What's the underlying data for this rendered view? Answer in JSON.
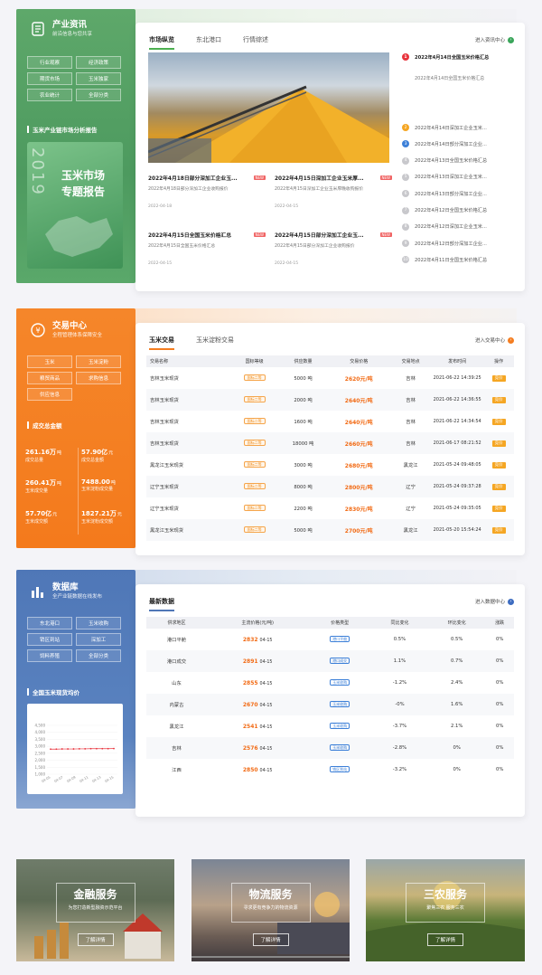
{
  "industry": {
    "title": "产业资讯",
    "subtitle": "前沿信息与您共享",
    "buttons": [
      "行业观察",
      "经济政策",
      "期货市场",
      "玉米独家",
      "农业统计",
      "全部分类"
    ],
    "report_section": "玉米产业链市场分析报告",
    "report_year": "2019",
    "report_title1": "玉米市场",
    "report_title2": "专题报告",
    "tabs": [
      "市场纵览",
      "东北港口",
      "行情综述"
    ],
    "more": "进入资讯中心",
    "news": [
      {
        "title": "2022年4月18日部分深加工企业玉...",
        "desc": "2022年4月18日部分深加工企业收购报价",
        "date": "2022-04-18",
        "badge": "NEW"
      },
      {
        "title": "2022年4月15日深加工企业玉米厚...",
        "desc": "2022年4月15日深加工企业玉米厚晚收购报价",
        "date": "2022-04-15",
        "badge": "NEW"
      },
      {
        "title": "2022年4月15日全国玉米价格汇总",
        "desc": "2022年4月15日全国玉米价格汇总",
        "date": "2022-04-15",
        "badge": "NEW"
      },
      {
        "title": "2022年4月15日部分深加工企业玉...",
        "desc": "2022年4月15日部分深加工企业收购报价",
        "date": "2022-04-15",
        "badge": "NEW"
      }
    ],
    "top_item": {
      "n": "1",
      "title": "2022年4月14日全国玉米价格汇总",
      "desc": "2022年4月14日全国玉米价格汇总"
    },
    "list": [
      {
        "n": "2",
        "t": "2022年4月14日深加工企业玉米..."
      },
      {
        "n": "3",
        "t": "2022年4月14日部分深加工企业..."
      },
      {
        "n": "4",
        "t": "2022年4月13日全国玉米价格汇总"
      },
      {
        "n": "5",
        "t": "2022年4月13日深加工企业玉米..."
      },
      {
        "n": "6",
        "t": "2022年4月13日部分深加工企业..."
      },
      {
        "n": "7",
        "t": "2022年4月12日全国玉米价格汇总"
      },
      {
        "n": "8",
        "t": "2022年4月12日深加工企业玉米..."
      },
      {
        "n": "9",
        "t": "2022年4月12日部分深加工企业..."
      },
      {
        "n": "10",
        "t": "2022年4月11日全国玉米价格汇总"
      }
    ]
  },
  "trade": {
    "title": "交易中心",
    "subtitle": "全程管理体系保障安全",
    "buttons": [
      "玉米",
      "玉米淀粉",
      "粮贸商品",
      "求购信息",
      "供应信息"
    ],
    "stats_title": "成交总金额",
    "stats": [
      {
        "v": "261.16万",
        "u": "吨",
        "l": "成交总量"
      },
      {
        "v": "57.90亿",
        "u": "元",
        "l": "成交总金额"
      },
      {
        "v": "260.41万",
        "u": "吨",
        "l": "玉米成交量"
      },
      {
        "v": "7488.00",
        "u": "吨",
        "l": "玉米淀粉成交量"
      },
      {
        "v": "57.70亿",
        "u": "元",
        "l": "玉米成交额"
      },
      {
        "v": "1827.21万",
        "u": "元",
        "l": "玉米淀粉成交额"
      }
    ],
    "tabs": [
      "玉米交易",
      "玉米淀粉交易"
    ],
    "more": "进入交易中心",
    "headers": [
      "交易名称",
      "国标等级",
      "供应数量",
      "交易价格",
      "交易地点",
      "发布时间",
      "操作"
    ],
    "rows": [
      {
        "name": "吉林玉米现货",
        "grade": "国标二等",
        "qty": "5000 吨",
        "price": "2620元/吨",
        "loc": "吉林",
        "time": "2021-06-22 14:39:25",
        "op": "竞价"
      },
      {
        "name": "吉林玉米现货",
        "grade": "国标二等",
        "qty": "2000 吨",
        "price": "2640元/吨",
        "loc": "吉林",
        "time": "2021-06-22 14:36:55",
        "op": "竞价"
      },
      {
        "name": "吉林玉米现货",
        "grade": "国标二等",
        "qty": "1600 吨",
        "price": "2640元/吨",
        "loc": "吉林",
        "time": "2021-06-22 14:34:54",
        "op": "竞价"
      },
      {
        "name": "吉林玉米现货",
        "grade": "国标二等",
        "qty": "18000 吨",
        "price": "2660元/吨",
        "loc": "吉林",
        "time": "2021-06-17 08:21:52",
        "op": "竞价"
      },
      {
        "name": "黑龙江玉米现货",
        "grade": "国标二等",
        "qty": "3000 吨",
        "price": "2680元/吨",
        "loc": "黑龙江",
        "time": "2021-05-24 09:48:05",
        "op": "竞价"
      },
      {
        "name": "辽宁玉米现货",
        "grade": "国标二等",
        "qty": "8000 吨",
        "price": "2800元/吨",
        "loc": "辽宁",
        "time": "2021-05-24 09:37:28",
        "op": "竞价"
      },
      {
        "name": "辽宁玉米现货",
        "grade": "国标二等",
        "qty": "2200 吨",
        "price": "2830元/吨",
        "loc": "辽宁",
        "time": "2021-05-24 09:35:05",
        "op": "竞价"
      },
      {
        "name": "黑龙江玉米现货",
        "grade": "国标二等",
        "qty": "5000 吨",
        "price": "2700元/吨",
        "loc": "黑龙江",
        "time": "2021-05-20 15:54:24",
        "op": "竞价"
      }
    ]
  },
  "database": {
    "title": "数据库",
    "subtitle": "全产业链数据在线发布",
    "buttons": [
      "东北港口",
      "玉米收购",
      "销区到站",
      "深加工",
      "饲料养殖",
      "全部分类"
    ],
    "chart_title": "全国玉米现货均价",
    "tabs": [
      "最新数据"
    ],
    "more": "进入数据中心",
    "headers": [
      "供求地区",
      "主流价格(元/吨)",
      "价格类型",
      "同比变化",
      "环比变化",
      "涨跌"
    ],
    "rows": [
      {
        "region": "港口平舱",
        "price": "2832",
        "date": "04-15",
        "type": "港口平舱",
        "yoy": "0.5%",
        "yoy_dir": "up",
        "mom": "0.5%",
        "mom_dir": "up",
        "chg": "0%"
      },
      {
        "region": "港口成交",
        "price": "2891",
        "date": "04-15",
        "type": "港口成交",
        "yoy": "1.1%",
        "yoy_dir": "up",
        "mom": "0.7%",
        "mom_dir": "up",
        "chg": "0%"
      },
      {
        "region": "山东",
        "price": "2855",
        "date": "04-15",
        "type": "玉米收购",
        "yoy": "-1.2%",
        "yoy_dir": "dn",
        "mom": "2.4%",
        "mom_dir": "up",
        "chg": "0%"
      },
      {
        "region": "内蒙古",
        "price": "2670",
        "date": "04-15",
        "type": "玉米收购",
        "yoy": "-0%",
        "yoy_dir": "dn",
        "mom": "1.6%",
        "mom_dir": "up",
        "chg": "0%"
      },
      {
        "region": "黑龙江",
        "price": "2541",
        "date": "04-15",
        "type": "玉米收购",
        "yoy": "-3.7%",
        "yoy_dir": "dn",
        "mom": "2.1%",
        "mom_dir": "up",
        "chg": "0%"
      },
      {
        "region": "吉林",
        "price": "2576",
        "date": "04-15",
        "type": "玉米收购",
        "yoy": "-2.8%",
        "yoy_dir": "dn",
        "mom": "0%",
        "mom_dir": "none",
        "chg": "0%"
      },
      {
        "region": "江西",
        "price": "2850",
        "date": "04-15",
        "type": "销区到站",
        "yoy": "-3.2%",
        "yoy_dir": "dn",
        "mom": "0%",
        "mom_dir": "none",
        "chg": "0%"
      }
    ]
  },
  "chart_data": {
    "type": "line",
    "title": "",
    "yticks": [
      "4,500",
      "4,000",
      "3,500",
      "3,000",
      "2,500",
      "2,000",
      "1,500",
      "1,000"
    ],
    "ylim": [
      1000,
      4500
    ],
    "x": [
      "04-05",
      "04-07",
      "04-09",
      "04-11",
      "04-13",
      "04-15"
    ],
    "series": [
      {
        "values": [
          2800,
          2800,
          2810,
          2810,
          2810,
          2820,
          2820,
          2830,
          2830,
          2830,
          2830,
          2840
        ]
      }
    ]
  },
  "services": [
    {
      "title": "金融服务",
      "sub": "为您打造新型融资示范平台",
      "btn": "了解详情"
    },
    {
      "title": "物流服务",
      "sub": "寻求更有竞争力的物流资源",
      "btn": "了解详情"
    },
    {
      "title": "三农服务",
      "sub": "聚焦三农 服务三农",
      "btn": "了解详情"
    }
  ],
  "colors": {
    "green": "#4a9a5e",
    "orange": "#f47d20",
    "blue": "#4f77b7"
  }
}
